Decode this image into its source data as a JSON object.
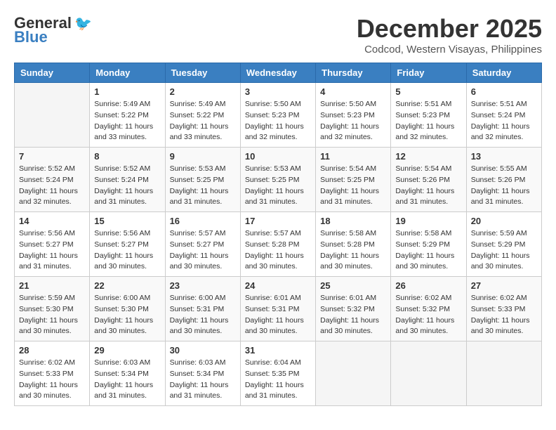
{
  "header": {
    "logo_general": "General",
    "logo_blue": "Blue",
    "month_title": "December 2025",
    "subtitle": "Codcod, Western Visayas, Philippines"
  },
  "days_of_week": [
    "Sunday",
    "Monday",
    "Tuesday",
    "Wednesday",
    "Thursday",
    "Friday",
    "Saturday"
  ],
  "weeks": [
    [
      {
        "day": "",
        "sunrise": "",
        "sunset": "",
        "daylight": ""
      },
      {
        "day": "1",
        "sunrise": "Sunrise: 5:49 AM",
        "sunset": "Sunset: 5:22 PM",
        "daylight": "Daylight: 11 hours and 33 minutes."
      },
      {
        "day": "2",
        "sunrise": "Sunrise: 5:49 AM",
        "sunset": "Sunset: 5:22 PM",
        "daylight": "Daylight: 11 hours and 33 minutes."
      },
      {
        "day": "3",
        "sunrise": "Sunrise: 5:50 AM",
        "sunset": "Sunset: 5:23 PM",
        "daylight": "Daylight: 11 hours and 32 minutes."
      },
      {
        "day": "4",
        "sunrise": "Sunrise: 5:50 AM",
        "sunset": "Sunset: 5:23 PM",
        "daylight": "Daylight: 11 hours and 32 minutes."
      },
      {
        "day": "5",
        "sunrise": "Sunrise: 5:51 AM",
        "sunset": "Sunset: 5:23 PM",
        "daylight": "Daylight: 11 hours and 32 minutes."
      },
      {
        "day": "6",
        "sunrise": "Sunrise: 5:51 AM",
        "sunset": "Sunset: 5:24 PM",
        "daylight": "Daylight: 11 hours and 32 minutes."
      }
    ],
    [
      {
        "day": "7",
        "sunrise": "Sunrise: 5:52 AM",
        "sunset": "Sunset: 5:24 PM",
        "daylight": "Daylight: 11 hours and 32 minutes."
      },
      {
        "day": "8",
        "sunrise": "Sunrise: 5:52 AM",
        "sunset": "Sunset: 5:24 PM",
        "daylight": "Daylight: 11 hours and 31 minutes."
      },
      {
        "day": "9",
        "sunrise": "Sunrise: 5:53 AM",
        "sunset": "Sunset: 5:25 PM",
        "daylight": "Daylight: 11 hours and 31 minutes."
      },
      {
        "day": "10",
        "sunrise": "Sunrise: 5:53 AM",
        "sunset": "Sunset: 5:25 PM",
        "daylight": "Daylight: 11 hours and 31 minutes."
      },
      {
        "day": "11",
        "sunrise": "Sunrise: 5:54 AM",
        "sunset": "Sunset: 5:25 PM",
        "daylight": "Daylight: 11 hours and 31 minutes."
      },
      {
        "day": "12",
        "sunrise": "Sunrise: 5:54 AM",
        "sunset": "Sunset: 5:26 PM",
        "daylight": "Daylight: 11 hours and 31 minutes."
      },
      {
        "day": "13",
        "sunrise": "Sunrise: 5:55 AM",
        "sunset": "Sunset: 5:26 PM",
        "daylight": "Daylight: 11 hours and 31 minutes."
      }
    ],
    [
      {
        "day": "14",
        "sunrise": "Sunrise: 5:56 AM",
        "sunset": "Sunset: 5:27 PM",
        "daylight": "Daylight: 11 hours and 31 minutes."
      },
      {
        "day": "15",
        "sunrise": "Sunrise: 5:56 AM",
        "sunset": "Sunset: 5:27 PM",
        "daylight": "Daylight: 11 hours and 30 minutes."
      },
      {
        "day": "16",
        "sunrise": "Sunrise: 5:57 AM",
        "sunset": "Sunset: 5:27 PM",
        "daylight": "Daylight: 11 hours and 30 minutes."
      },
      {
        "day": "17",
        "sunrise": "Sunrise: 5:57 AM",
        "sunset": "Sunset: 5:28 PM",
        "daylight": "Daylight: 11 hours and 30 minutes."
      },
      {
        "day": "18",
        "sunrise": "Sunrise: 5:58 AM",
        "sunset": "Sunset: 5:28 PM",
        "daylight": "Daylight: 11 hours and 30 minutes."
      },
      {
        "day": "19",
        "sunrise": "Sunrise: 5:58 AM",
        "sunset": "Sunset: 5:29 PM",
        "daylight": "Daylight: 11 hours and 30 minutes."
      },
      {
        "day": "20",
        "sunrise": "Sunrise: 5:59 AM",
        "sunset": "Sunset: 5:29 PM",
        "daylight": "Daylight: 11 hours and 30 minutes."
      }
    ],
    [
      {
        "day": "21",
        "sunrise": "Sunrise: 5:59 AM",
        "sunset": "Sunset: 5:30 PM",
        "daylight": "Daylight: 11 hours and 30 minutes."
      },
      {
        "day": "22",
        "sunrise": "Sunrise: 6:00 AM",
        "sunset": "Sunset: 5:30 PM",
        "daylight": "Daylight: 11 hours and 30 minutes."
      },
      {
        "day": "23",
        "sunrise": "Sunrise: 6:00 AM",
        "sunset": "Sunset: 5:31 PM",
        "daylight": "Daylight: 11 hours and 30 minutes."
      },
      {
        "day": "24",
        "sunrise": "Sunrise: 6:01 AM",
        "sunset": "Sunset: 5:31 PM",
        "daylight": "Daylight: 11 hours and 30 minutes."
      },
      {
        "day": "25",
        "sunrise": "Sunrise: 6:01 AM",
        "sunset": "Sunset: 5:32 PM",
        "daylight": "Daylight: 11 hours and 30 minutes."
      },
      {
        "day": "26",
        "sunrise": "Sunrise: 6:02 AM",
        "sunset": "Sunset: 5:32 PM",
        "daylight": "Daylight: 11 hours and 30 minutes."
      },
      {
        "day": "27",
        "sunrise": "Sunrise: 6:02 AM",
        "sunset": "Sunset: 5:33 PM",
        "daylight": "Daylight: 11 hours and 30 minutes."
      }
    ],
    [
      {
        "day": "28",
        "sunrise": "Sunrise: 6:02 AM",
        "sunset": "Sunset: 5:33 PM",
        "daylight": "Daylight: 11 hours and 30 minutes."
      },
      {
        "day": "29",
        "sunrise": "Sunrise: 6:03 AM",
        "sunset": "Sunset: 5:34 PM",
        "daylight": "Daylight: 11 hours and 31 minutes."
      },
      {
        "day": "30",
        "sunrise": "Sunrise: 6:03 AM",
        "sunset": "Sunset: 5:34 PM",
        "daylight": "Daylight: 11 hours and 31 minutes."
      },
      {
        "day": "31",
        "sunrise": "Sunrise: 6:04 AM",
        "sunset": "Sunset: 5:35 PM",
        "daylight": "Daylight: 11 hours and 31 minutes."
      },
      {
        "day": "",
        "sunrise": "",
        "sunset": "",
        "daylight": ""
      },
      {
        "day": "",
        "sunrise": "",
        "sunset": "",
        "daylight": ""
      },
      {
        "day": "",
        "sunrise": "",
        "sunset": "",
        "daylight": ""
      }
    ]
  ]
}
